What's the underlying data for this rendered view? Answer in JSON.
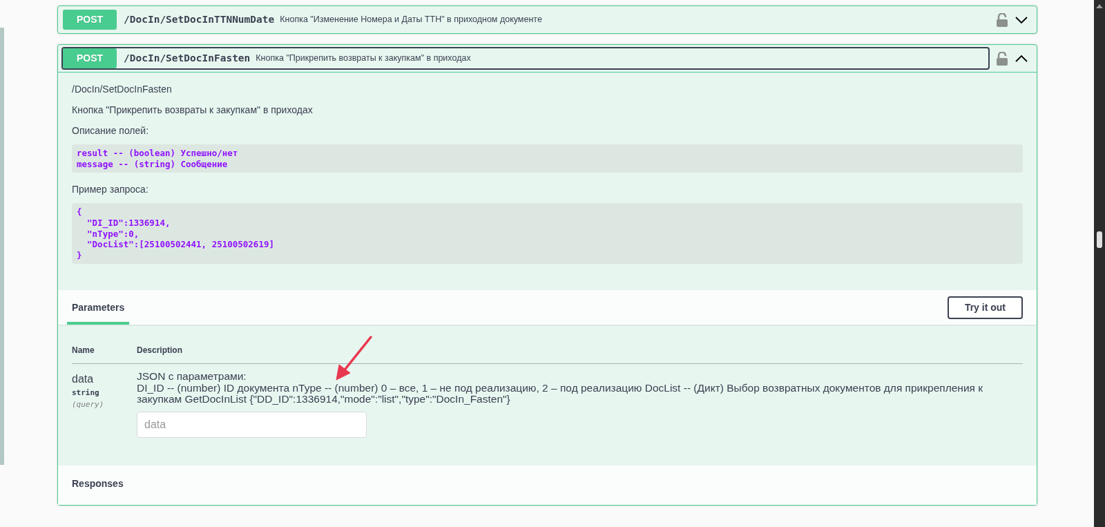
{
  "operations": [
    {
      "method": "POST",
      "path": "/DocIn/SetDocInTTNNumDate",
      "summary": "Кнопка \"Изменение Номера и Даты ТТН\" в приходном документе",
      "expanded": false,
      "focused": false
    },
    {
      "method": "POST",
      "path": "/DocIn/SetDocInFasten",
      "summary": "Кнопка \"Прикрепить возвраты к закупкам\" в приходах",
      "expanded": true,
      "focused": true,
      "description": [
        {
          "kind": "text",
          "text": "/DocIn/SetDocInFasten"
        },
        {
          "kind": "text",
          "text": "Кнопка \"Прикрепить возвраты к закупкам\" в приходах"
        },
        {
          "kind": "text",
          "text": "Описание полей:"
        },
        {
          "kind": "code",
          "text": "result -- (boolean) Успешно/нет\nmessage -- (string) Сообщение"
        },
        {
          "kind": "text",
          "text": "Пример запроса:"
        },
        {
          "kind": "code",
          "text": "{\n  \"DI_ID\":1336914,\n  \"nType\":0,\n  \"DocList\":[25100502441, 25100502619]\n}"
        }
      ],
      "tabs": [
        {
          "label": "Parameters",
          "selected": true
        }
      ],
      "try_button": "Try it out",
      "columns": [
        "Name",
        "Description"
      ],
      "parameters": [
        {
          "name": "data",
          "type": "string",
          "location": "(query)",
          "description": [
            "JSON с параметрами:",
            "DI_ID -- (number) ID документа nType -- (number) 0 – все, 1 – не под реализацию, 2 – под реализацию DocList -- (Дикт) Выбор возвратных документов для прикрепления к закупкам GetDocInList {\"DD_ID\":1336914,\"mode\":\"list\",\"type\":\"DocIn_Fasten\"}"
          ],
          "placeholder": "data"
        }
      ],
      "responses_title": "Responses"
    }
  ]
}
